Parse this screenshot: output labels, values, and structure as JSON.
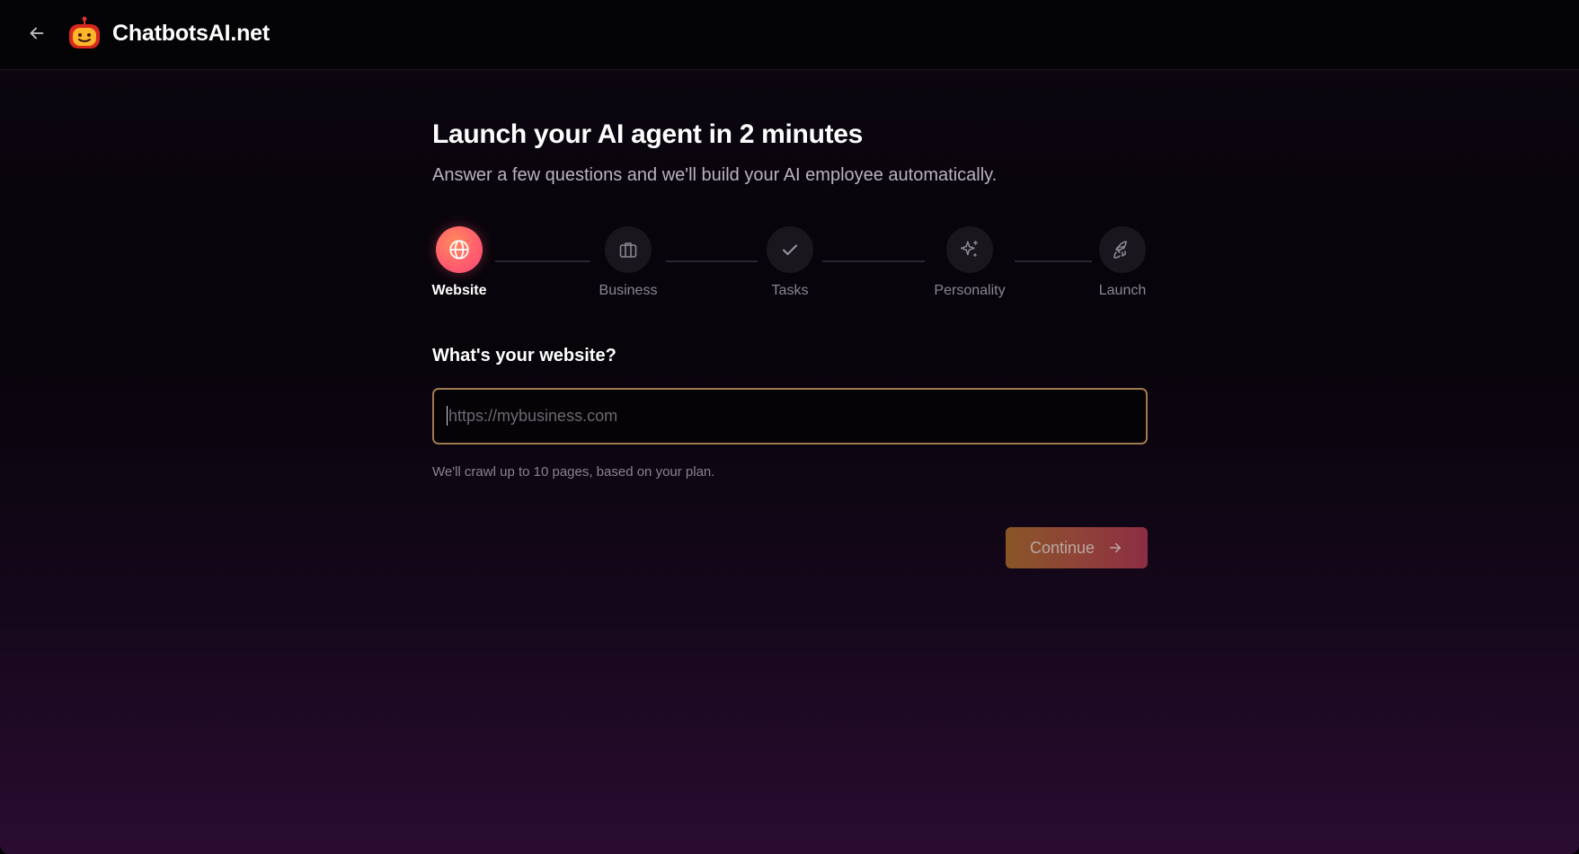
{
  "header": {
    "brand": "ChatbotsAI.net",
    "back_icon": "arrow-left-icon",
    "logo_icon": "robot-logo-icon"
  },
  "main": {
    "title": "Launch your AI agent in 2 minutes",
    "subtitle": "Answer a few questions and we'll build your AI employee automatically.",
    "steps": [
      {
        "label": "Website",
        "icon": "globe-icon",
        "active": true
      },
      {
        "label": "Business",
        "icon": "briefcase-icon",
        "active": false
      },
      {
        "label": "Tasks",
        "icon": "check-icon",
        "active": false
      },
      {
        "label": "Personality",
        "icon": "sparkles-icon",
        "active": false
      },
      {
        "label": "Launch",
        "icon": "rocket-icon",
        "active": false
      }
    ],
    "question": "What's your website?",
    "url_input": {
      "value": "",
      "placeholder": "https://mybusiness.com"
    },
    "hint": "We'll crawl up to 10 pages, based on your plan.",
    "continue_label": "Continue"
  },
  "colors": {
    "accent_gradient_start": "#ff8a5c",
    "accent_gradient_end": "#f5477a",
    "input_border": "#a07a4e"
  }
}
